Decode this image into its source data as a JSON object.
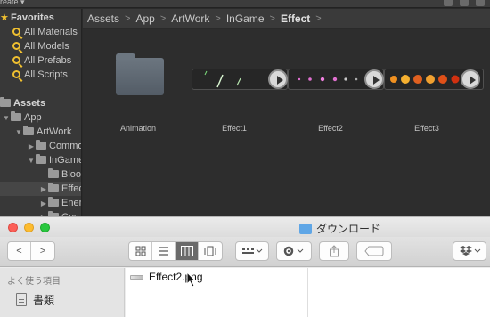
{
  "unity": {
    "create_label": "reate ▾",
    "tree": {
      "favorites": "Favorites",
      "fav_items": [
        "All Materials",
        "All Models",
        "All Prefabs",
        "All Scripts"
      ],
      "assets": "Assets",
      "app": "App",
      "artwork": "ArtWork",
      "common": "Common",
      "ingame": "InGame",
      "bloom": "Bloom",
      "effect": "Effect",
      "enemy": "Enemy",
      "cos": "Cos"
    },
    "breadcrumb": [
      "Assets",
      "App",
      "ArtWork",
      "InGame",
      "Effect"
    ],
    "grid_items": [
      "Animation",
      "Effect1",
      "Effect2",
      "Effect3"
    ]
  },
  "finder": {
    "window_title": "ダウンロード",
    "sidebar_heading": "よく使う項目",
    "sidebar_item": "書類",
    "file_name": "Effect2.png",
    "nav_back": "<",
    "nav_forward": ">"
  },
  "colors": {
    "unity_bg": "#2d2d2d",
    "selection": "#3b5a86",
    "favorite_accent": "#f0c030",
    "finder_bg": "#ececec"
  }
}
